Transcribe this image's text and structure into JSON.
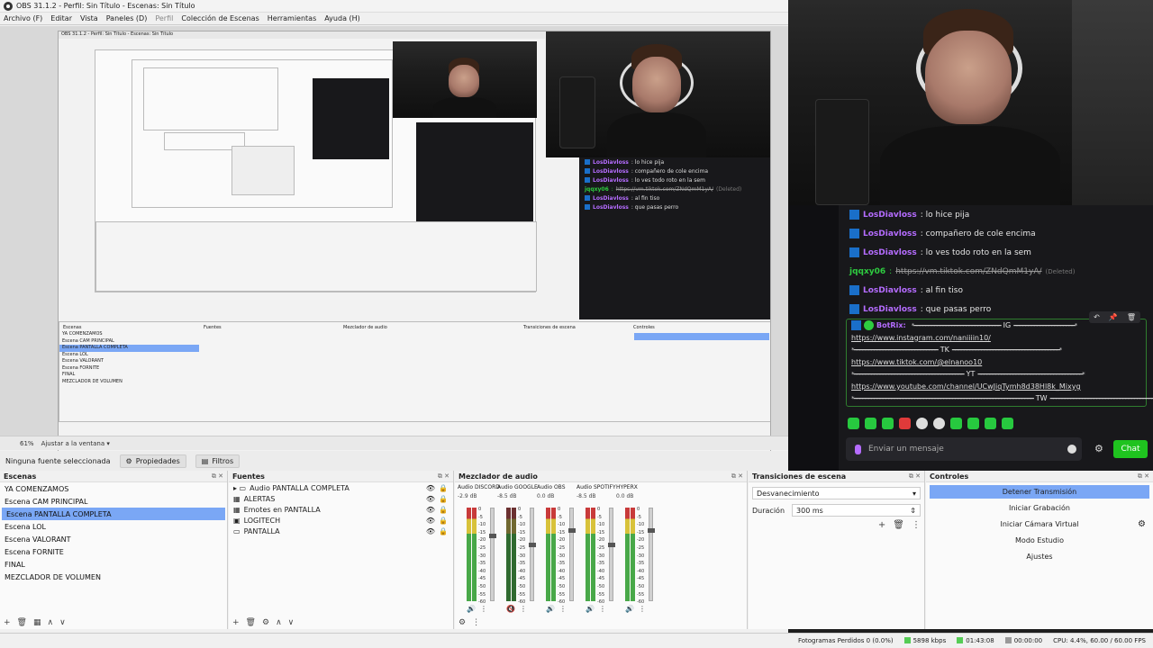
{
  "window": {
    "title": "OBS 31.1.2 - Perfil: Sin Título - Escenas: Sin Título"
  },
  "menu": [
    "Archivo (F)",
    "Editar",
    "Vista",
    "Paneles (D)",
    "Perfil",
    "Colección de Escenas",
    "Herramientas",
    "Ayuda (H)"
  ],
  "preview_status": {
    "zoom": "61%",
    "fit": "Ajustar a la ventana"
  },
  "source_bar": {
    "no_source": "Ninguna fuente seleccionada",
    "properties": "Propiedades",
    "filters": "Filtros"
  },
  "scenes": {
    "title": "Escenas",
    "items": [
      "YA COMENZAMOS",
      "Escena CAM PRINCIPAL",
      "Escena PANTALLA COMPLETA",
      "Escena LOL",
      "Escena VALORANT",
      "Escena FORNITE",
      "FINAL",
      "MEZCLADOR DE VOLUMEN"
    ],
    "selected_index": 2
  },
  "sources": {
    "title": "Fuentes",
    "items": [
      {
        "label": "Audio PANTALLA COMPLETA",
        "icon": "folder-icon"
      },
      {
        "label": "ALERTAS",
        "icon": "browser-icon"
      },
      {
        "label": "Emotes en PANTALLA",
        "icon": "browser-icon"
      },
      {
        "label": "LOGITECH",
        "icon": "camera-icon"
      },
      {
        "label": "PANTALLA",
        "icon": "display-icon"
      }
    ]
  },
  "mixer": {
    "title": "Mezclador de audio",
    "channels": [
      {
        "name": "Audio DISCORD",
        "db": "-2.9 dB",
        "level": 0.72,
        "muted": false
      },
      {
        "name": "Audio GOOGLE",
        "db": "-8.5 dB",
        "level": 0.62,
        "muted": true
      },
      {
        "name": "Audio OBS",
        "db": "0.0 dB",
        "level": 0.78,
        "muted": false
      },
      {
        "name": "Audio SPOTIFY",
        "db": "-8.5 dB",
        "level": 0.62,
        "muted": false
      },
      {
        "name": "HYPERX",
        "db": "0.0 dB",
        "level": 0.78,
        "muted": false
      }
    ],
    "scale": [
      "0",
      "-5",
      "-10",
      "-15",
      "-20",
      "-25",
      "-30",
      "-35",
      "-40",
      "-45",
      "-50",
      "-55",
      "-60"
    ]
  },
  "transitions": {
    "title": "Transiciones de escena",
    "selected": "Desvanecimiento",
    "duration_label": "Duración",
    "duration_value": "300 ms"
  },
  "controls": {
    "title": "Controles",
    "buttons": [
      "Detener Transmisión",
      "Iniciar Grabación",
      "Iniciar Cámara Virtual",
      "Modo Estudio",
      "Ajustes"
    ]
  },
  "statusbar": {
    "dropped": "Fotogramas Perdidos 0 (0.0%)",
    "bitrate": "5898 kbps",
    "stream_time": "01:43:08",
    "rec_time": "00:00:00",
    "cpu": "CPU: 4.4%, 60.00 / 60.00 FPS"
  },
  "chat": {
    "messages": [
      {
        "user": "LosDiavloss",
        "text": ": lo hice pija",
        "badge": true
      },
      {
        "user": "LosDiavloss",
        "text": ": compañero de cole encima",
        "badge": true
      },
      {
        "user": "LosDiavloss",
        "text": ": lo ves todo roto en la sem",
        "badge": true
      },
      {
        "user": "jqqxy06",
        "text": "https://vm.tiktok.com/ZNdQmM1yA/",
        "deleted": "(Deleted)",
        "badge": false
      },
      {
        "user": "LosDiavloss",
        "text": ": al fin tiso",
        "badge": true
      },
      {
        "user": "LosDiavloss",
        "text": ": que pasas perro",
        "badge": true
      }
    ],
    "pinned": {
      "user": "BotRix:",
      "ig_label": "IG",
      "ig_link": "https://www.instagram.com/naniiiin10/",
      "tk_label": "TK",
      "tk_link": "https://www.tiktok.com/@elnanoo10",
      "yt_label": "YT",
      "yt_link": "https://www.youtube.com/channel/UCwJiqTymh8d38Hl8k_Mixyg",
      "tw_label": "TW"
    },
    "input_placeholder": "Enviar un mensaje",
    "send_label": "Chat"
  },
  "nested_preview": {
    "title": "OBS 31.1.2 - Perfil: Sin Título - Escenas: Sin Título"
  },
  "colors": {
    "selection": "#7aa7f5",
    "chat_user": "#b56cff",
    "chat_send": "#1fc31f"
  }
}
